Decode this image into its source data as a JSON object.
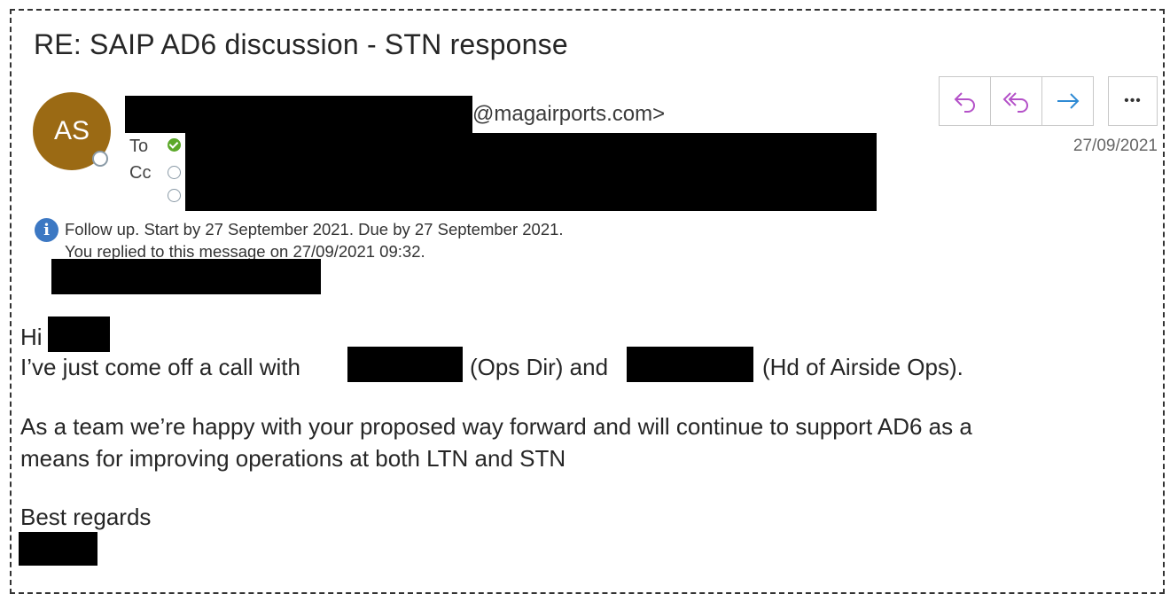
{
  "email": {
    "subject": "RE: SAIP AD6 discussion - STN response",
    "sender_initials": "AS",
    "from_email_suffix": "@magairports.com>",
    "to_label": "To",
    "cc_label": "Cc",
    "date": "27/09/2021",
    "follow_up": "Follow up.  Start by 27 September 2021.  Due by 27 September 2021.",
    "replied": "You replied to this message on 27/09/2021 09:32."
  },
  "actions": {
    "reply_icon": "reply-icon",
    "reply_all_icon": "reply-all-icon",
    "forward_icon": "forward-icon",
    "more_label": "•••"
  },
  "body": {
    "greeting": "Hi",
    "line1_a": "I’ve just come off a call with",
    "line1_b": "(Ops Dir) and",
    "line1_c": "(Hd of Airside Ops).",
    "para2_line1": "As a team we’re happy with your proposed way forward and will continue to support AD6 as a",
    "para2_line2": "means for improving operations at both LTN and STN",
    "signoff": "Best regards"
  },
  "colors": {
    "avatar": "#9b6a14",
    "reply_purple": "#b451c8",
    "forward_blue": "#2e8ad4",
    "info_blue": "#3c78c3",
    "presence_green": "#5ba829"
  }
}
